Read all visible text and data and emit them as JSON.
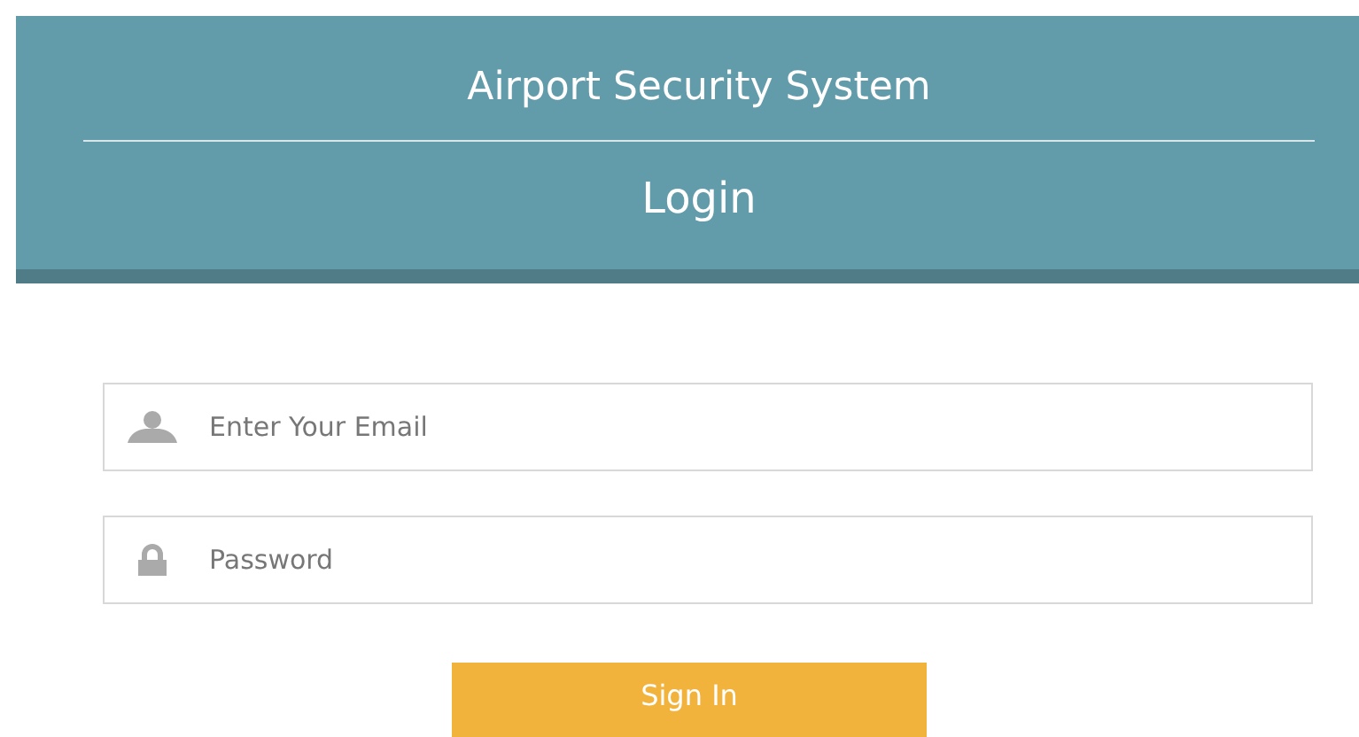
{
  "header": {
    "title": "Airport Security System",
    "subtitle": "Login"
  },
  "fields": [
    {
      "kind": "email",
      "placeholder": "Enter Your Email"
    },
    {
      "kind": "password",
      "placeholder": "Password"
    }
  ],
  "button": {
    "label": "Sign In"
  }
}
